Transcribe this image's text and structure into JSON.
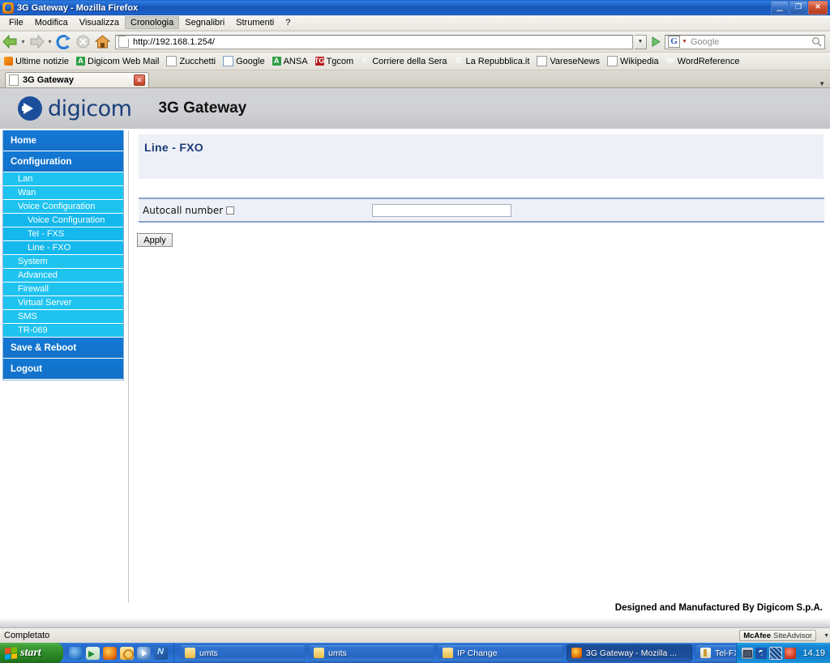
{
  "window": {
    "title": "3G Gateway - Mozilla Firefox",
    "minimize_label": "_",
    "maximize_label": "❐",
    "close_label": "✕"
  },
  "menubar": {
    "items": [
      {
        "label": "File",
        "active": false
      },
      {
        "label": "Modifica",
        "active": false
      },
      {
        "label": "Visualizza",
        "active": false
      },
      {
        "label": "Cronologia",
        "active": true
      },
      {
        "label": "Segnalibri",
        "active": false
      },
      {
        "label": "Strumenti",
        "active": false
      },
      {
        "label": "?",
        "active": false
      }
    ]
  },
  "toolbar": {
    "back_icon": "back-arrow-icon",
    "forward_icon": "forward-arrow-icon",
    "reload_icon": "reload-icon",
    "stop_icon": "stop-icon",
    "home_icon": "home-icon",
    "url_value": "http://192.168.1.254/",
    "url_dropdown_caret": "▼",
    "go_icon": "go-arrow-icon",
    "search_engine_badge": "G",
    "search_engine_caret": "▼",
    "search_placeholder": "Google",
    "search_icon": "magnifier-icon"
  },
  "bookmarks": {
    "items": [
      {
        "label": "Ultime notizie",
        "icon": "rss-icon",
        "icon_class": "ico-rss",
        "glyph": ""
      },
      {
        "label": "Digicom Web Mail",
        "icon": "letter-a-green-icon",
        "icon_class": "ico-green",
        "glyph": "A"
      },
      {
        "label": "Zucchetti",
        "icon": "page-icon",
        "icon_class": "ico-page",
        "glyph": ""
      },
      {
        "label": "Google",
        "icon": "google-icon",
        "icon_class": "ico-google",
        "glyph": "G"
      },
      {
        "label": "ANSA",
        "icon": "letter-a-green-icon",
        "icon_class": "ico-green",
        "glyph": "A"
      },
      {
        "label": "Tgcom",
        "icon": "tgcom-icon",
        "icon_class": "ico-tg",
        "glyph": "TG"
      },
      {
        "label": "Corriere della Sera",
        "icon": "corriere-icon",
        "icon_class": "ico-c",
        "glyph": "C"
      },
      {
        "label": "La Repubblica.it",
        "icon": "repubblica-icon",
        "icon_class": "ico-r",
        "glyph": "R"
      },
      {
        "label": "VareseNews",
        "icon": "page-icon",
        "icon_class": "ico-page",
        "glyph": ""
      },
      {
        "label": "Wikipedia",
        "icon": "page-icon",
        "icon_class": "ico-page",
        "glyph": ""
      },
      {
        "label": "WordReference",
        "icon": "wordreference-icon",
        "icon_class": "ico-w",
        "glyph": "W"
      }
    ]
  },
  "tabs": {
    "items": [
      {
        "label": "3G Gateway",
        "close_label": "✕"
      }
    ],
    "list_caret": "▼"
  },
  "brand": {
    "logo_text": "digicom",
    "device_name": "3G Gateway"
  },
  "sidebar": {
    "items": [
      {
        "label": "Home",
        "level": "main"
      },
      {
        "label": "Configuration",
        "level": "main"
      },
      {
        "label": "Lan",
        "level": "sub"
      },
      {
        "label": "Wan",
        "level": "sub"
      },
      {
        "label": "Voice Configuration",
        "level": "sub"
      },
      {
        "label": "Voice Configuration",
        "level": "sub2"
      },
      {
        "label": "Tel - FXS",
        "level": "sub2"
      },
      {
        "label": "Line - FXO",
        "level": "sub2"
      },
      {
        "label": "System",
        "level": "sub"
      },
      {
        "label": "Advanced",
        "level": "sub"
      },
      {
        "label": "Firewall",
        "level": "sub"
      },
      {
        "label": "Virtual Server",
        "level": "sub"
      },
      {
        "label": "SMS",
        "level": "sub"
      },
      {
        "label": "TR-069",
        "level": "sub"
      },
      {
        "label": "Save & Reboot",
        "level": "main"
      },
      {
        "label": "Logout",
        "level": "main"
      }
    ]
  },
  "main": {
    "page_title": "Line - FXO",
    "form": {
      "autocall_label": "Autocall number",
      "autocall_checked": false,
      "autocall_value": "",
      "autocall_placeholder": ""
    },
    "apply_label": "Apply",
    "footer_text": "Designed and Manufactured By Digicom S.p.A."
  },
  "statusbar": {
    "status_text": "Completato",
    "siteadvisor_brand": "McAfee",
    "siteadvisor_sub": "SiteAdvisor",
    "siteadvisor_caret": "▼"
  },
  "taskbar": {
    "start_label": "start",
    "quicklaunch": [
      {
        "name": "ie-icon",
        "cls": "ql1"
      },
      {
        "name": "show-desktop-icon",
        "cls": "ql2"
      },
      {
        "name": "firefox-icon",
        "cls": "ql3"
      },
      {
        "name": "clock-icon",
        "cls": "ql4"
      },
      {
        "name": "media-player-icon",
        "cls": "ql5"
      },
      {
        "name": "nero-icon",
        "cls": "ql6"
      }
    ],
    "tasks": [
      {
        "label": "umts",
        "icon": "folder-icon",
        "icon_cls": "tk-folder",
        "active": false
      },
      {
        "label": "umts",
        "icon": "folder-icon",
        "icon_cls": "tk-folder",
        "active": false
      },
      {
        "label": "IP Change",
        "icon": "folder-icon",
        "icon_cls": "tk-folder",
        "active": false
      },
      {
        "label": "3G Gateway - Mozilla ...",
        "icon": "firefox-icon",
        "icon_cls": "tk-ff",
        "active": true
      },
      {
        "label": "Tel-FXS.JPG - Paint",
        "icon": "paint-icon",
        "icon_cls": "tk-paint",
        "active": false
      }
    ],
    "tray_icons": [
      {
        "name": "network-icon",
        "cls": "tr1"
      },
      {
        "name": "antivirus-shield-icon",
        "cls": "tr2"
      },
      {
        "name": "security-center-icon",
        "cls": "tr3"
      },
      {
        "name": "update-icon",
        "cls": "tr4"
      }
    ],
    "clock": "14.19"
  },
  "colors": {
    "brand_blue": "#1b3f7a",
    "nav_main_blue": "#1179d5",
    "nav_sub_cyan": "#1ec3f0",
    "nav_sub2_cyan": "#15b8ec",
    "panel_bg": "#eef0f7",
    "panel_rule": "#8ba3cc",
    "title_text": "#1a3a78"
  }
}
